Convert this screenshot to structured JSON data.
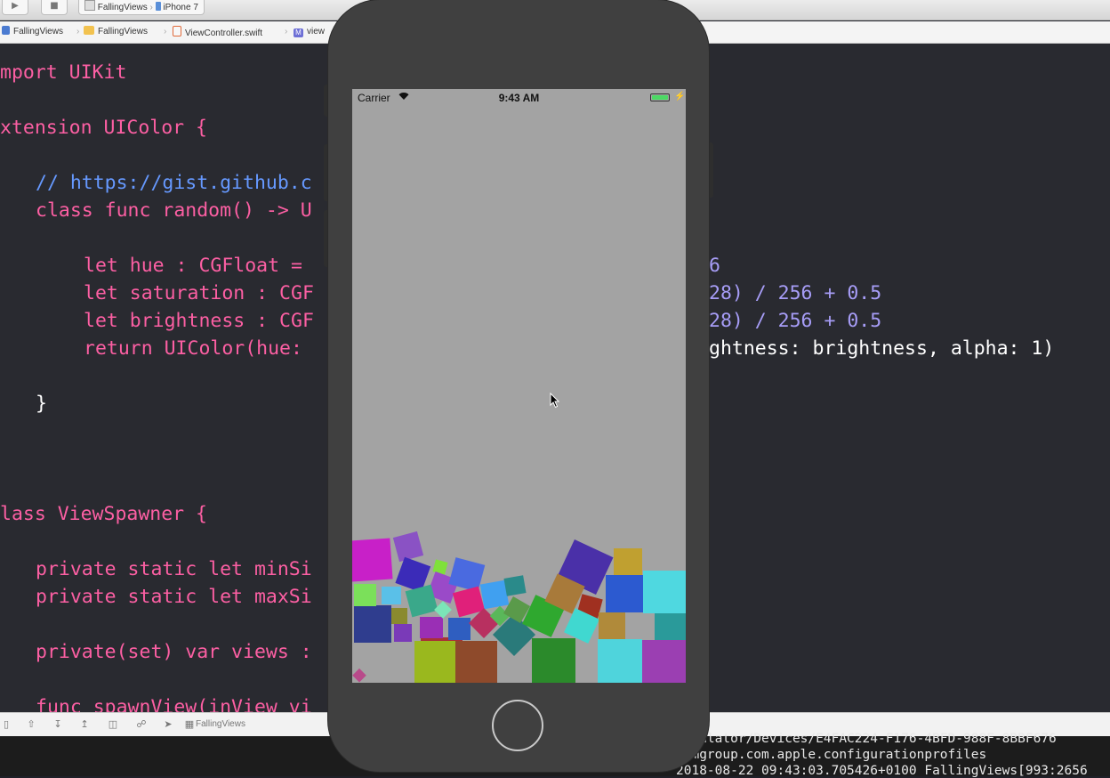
{
  "toolbar": {
    "scheme_app": "FallingViews",
    "scheme_device": "iPhone 7",
    "run_icon": "play-icon",
    "stop_icon": "stop-icon"
  },
  "breadcrumb": {
    "items": [
      "FallingViews",
      "FallingViews",
      "ViewController.swift",
      "view"
    ]
  },
  "editor": {
    "lines": [
      "mport UIKit",
      "xtension UIColor {",
      "// https://gist.github.c",
      "class func random() -> U",
      "let hue : CGFloat = ",
      "6",
      "let saturation : CGF",
      "28) / 256 + 0.5",
      "let brightness : CGF",
      "28) / 256 + 0.5",
      "return UIColor(hue: ",
      "ghtness: brightness, alpha: 1)",
      "}",
      "lass ViewSpawner {",
      "private static let minSi",
      "private static let maxSi",
      "private(set) var views :",
      "func spawnView(inView vi"
    ]
  },
  "debugbar": {
    "target": "FallingViews"
  },
  "console": {
    "lines": [
      "Simulator/Devices/E4FAC224-F176-4BFD-988F-8BBF676",
      "temgroup.com.apple.configurationprofiles",
      "2018-08-22 09:43:03.705426+0100 FallingViews[993:2656"
    ]
  },
  "simulator": {
    "carrier": "Carrier",
    "time": "9:43 AM",
    "screen_color": "#a3a3a3"
  },
  "colors": {
    "keyword": "#fc5fa3",
    "type": "#5dd8ff",
    "comment": "#6c7986",
    "number": "#a79df7",
    "editor_bg": "#292a30"
  }
}
